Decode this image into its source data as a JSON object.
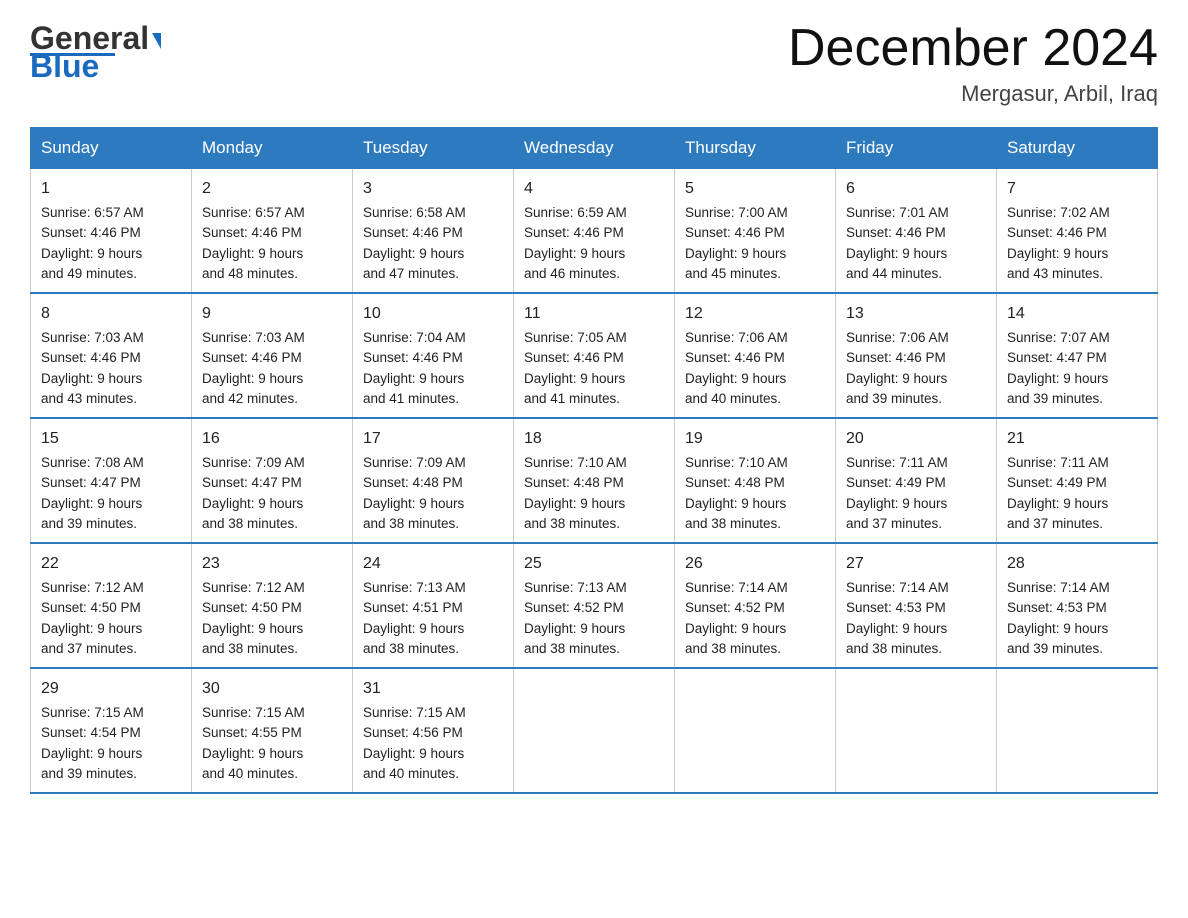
{
  "header": {
    "logo_general": "General",
    "logo_blue": "Blue",
    "month_title": "December 2024",
    "location": "Mergasur, Arbil, Iraq"
  },
  "days_of_week": [
    "Sunday",
    "Monday",
    "Tuesday",
    "Wednesday",
    "Thursday",
    "Friday",
    "Saturday"
  ],
  "weeks": [
    [
      {
        "day": "1",
        "sunrise": "6:57 AM",
        "sunset": "4:46 PM",
        "daylight": "9 hours and 49 minutes."
      },
      {
        "day": "2",
        "sunrise": "6:57 AM",
        "sunset": "4:46 PM",
        "daylight": "9 hours and 48 minutes."
      },
      {
        "day": "3",
        "sunrise": "6:58 AM",
        "sunset": "4:46 PM",
        "daylight": "9 hours and 47 minutes."
      },
      {
        "day": "4",
        "sunrise": "6:59 AM",
        "sunset": "4:46 PM",
        "daylight": "9 hours and 46 minutes."
      },
      {
        "day": "5",
        "sunrise": "7:00 AM",
        "sunset": "4:46 PM",
        "daylight": "9 hours and 45 minutes."
      },
      {
        "day": "6",
        "sunrise": "7:01 AM",
        "sunset": "4:46 PM",
        "daylight": "9 hours and 44 minutes."
      },
      {
        "day": "7",
        "sunrise": "7:02 AM",
        "sunset": "4:46 PM",
        "daylight": "9 hours and 43 minutes."
      }
    ],
    [
      {
        "day": "8",
        "sunrise": "7:03 AM",
        "sunset": "4:46 PM",
        "daylight": "9 hours and 43 minutes."
      },
      {
        "day": "9",
        "sunrise": "7:03 AM",
        "sunset": "4:46 PM",
        "daylight": "9 hours and 42 minutes."
      },
      {
        "day": "10",
        "sunrise": "7:04 AM",
        "sunset": "4:46 PM",
        "daylight": "9 hours and 41 minutes."
      },
      {
        "day": "11",
        "sunrise": "7:05 AM",
        "sunset": "4:46 PM",
        "daylight": "9 hours and 41 minutes."
      },
      {
        "day": "12",
        "sunrise": "7:06 AM",
        "sunset": "4:46 PM",
        "daylight": "9 hours and 40 minutes."
      },
      {
        "day": "13",
        "sunrise": "7:06 AM",
        "sunset": "4:46 PM",
        "daylight": "9 hours and 39 minutes."
      },
      {
        "day": "14",
        "sunrise": "7:07 AM",
        "sunset": "4:47 PM",
        "daylight": "9 hours and 39 minutes."
      }
    ],
    [
      {
        "day": "15",
        "sunrise": "7:08 AM",
        "sunset": "4:47 PM",
        "daylight": "9 hours and 39 minutes."
      },
      {
        "day": "16",
        "sunrise": "7:09 AM",
        "sunset": "4:47 PM",
        "daylight": "9 hours and 38 minutes."
      },
      {
        "day": "17",
        "sunrise": "7:09 AM",
        "sunset": "4:48 PM",
        "daylight": "9 hours and 38 minutes."
      },
      {
        "day": "18",
        "sunrise": "7:10 AM",
        "sunset": "4:48 PM",
        "daylight": "9 hours and 38 minutes."
      },
      {
        "day": "19",
        "sunrise": "7:10 AM",
        "sunset": "4:48 PM",
        "daylight": "9 hours and 38 minutes."
      },
      {
        "day": "20",
        "sunrise": "7:11 AM",
        "sunset": "4:49 PM",
        "daylight": "9 hours and 37 minutes."
      },
      {
        "day": "21",
        "sunrise": "7:11 AM",
        "sunset": "4:49 PM",
        "daylight": "9 hours and 37 minutes."
      }
    ],
    [
      {
        "day": "22",
        "sunrise": "7:12 AM",
        "sunset": "4:50 PM",
        "daylight": "9 hours and 37 minutes."
      },
      {
        "day": "23",
        "sunrise": "7:12 AM",
        "sunset": "4:50 PM",
        "daylight": "9 hours and 38 minutes."
      },
      {
        "day": "24",
        "sunrise": "7:13 AM",
        "sunset": "4:51 PM",
        "daylight": "9 hours and 38 minutes."
      },
      {
        "day": "25",
        "sunrise": "7:13 AM",
        "sunset": "4:52 PM",
        "daylight": "9 hours and 38 minutes."
      },
      {
        "day": "26",
        "sunrise": "7:14 AM",
        "sunset": "4:52 PM",
        "daylight": "9 hours and 38 minutes."
      },
      {
        "day": "27",
        "sunrise": "7:14 AM",
        "sunset": "4:53 PM",
        "daylight": "9 hours and 38 minutes."
      },
      {
        "day": "28",
        "sunrise": "7:14 AM",
        "sunset": "4:53 PM",
        "daylight": "9 hours and 39 minutes."
      }
    ],
    [
      {
        "day": "29",
        "sunrise": "7:15 AM",
        "sunset": "4:54 PM",
        "daylight": "9 hours and 39 minutes."
      },
      {
        "day": "30",
        "sunrise": "7:15 AM",
        "sunset": "4:55 PM",
        "daylight": "9 hours and 40 minutes."
      },
      {
        "day": "31",
        "sunrise": "7:15 AM",
        "sunset": "4:56 PM",
        "daylight": "9 hours and 40 minutes."
      },
      null,
      null,
      null,
      null
    ]
  ],
  "labels": {
    "sunrise": "Sunrise:",
    "sunset": "Sunset:",
    "daylight": "Daylight:"
  }
}
